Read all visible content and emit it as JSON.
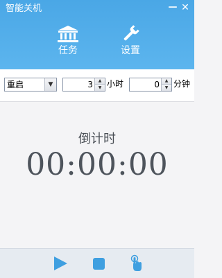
{
  "window": {
    "title": "智能关机",
    "minimize_icon": "minimize-icon",
    "close_icon": "close-icon",
    "header_color": "#5cb5ee"
  },
  "nav": {
    "tasks": {
      "label": "任务",
      "icon": "bank-icon"
    },
    "settings": {
      "label": "设置",
      "icon": "wrench-icon"
    }
  },
  "toolbar": {
    "action_select": {
      "selected": "重启"
    },
    "hours": {
      "value": "3",
      "unit": "小时"
    },
    "minutes": {
      "value": "0",
      "unit": "分钟"
    }
  },
  "countdown": {
    "label": "倒计时",
    "time": "00:00:00"
  },
  "controls": {
    "play_icon": "play-icon",
    "stop_icon": "stop-icon",
    "hand_icon": "hand-pointer-icon",
    "accent_color": "#3f9fe0"
  }
}
